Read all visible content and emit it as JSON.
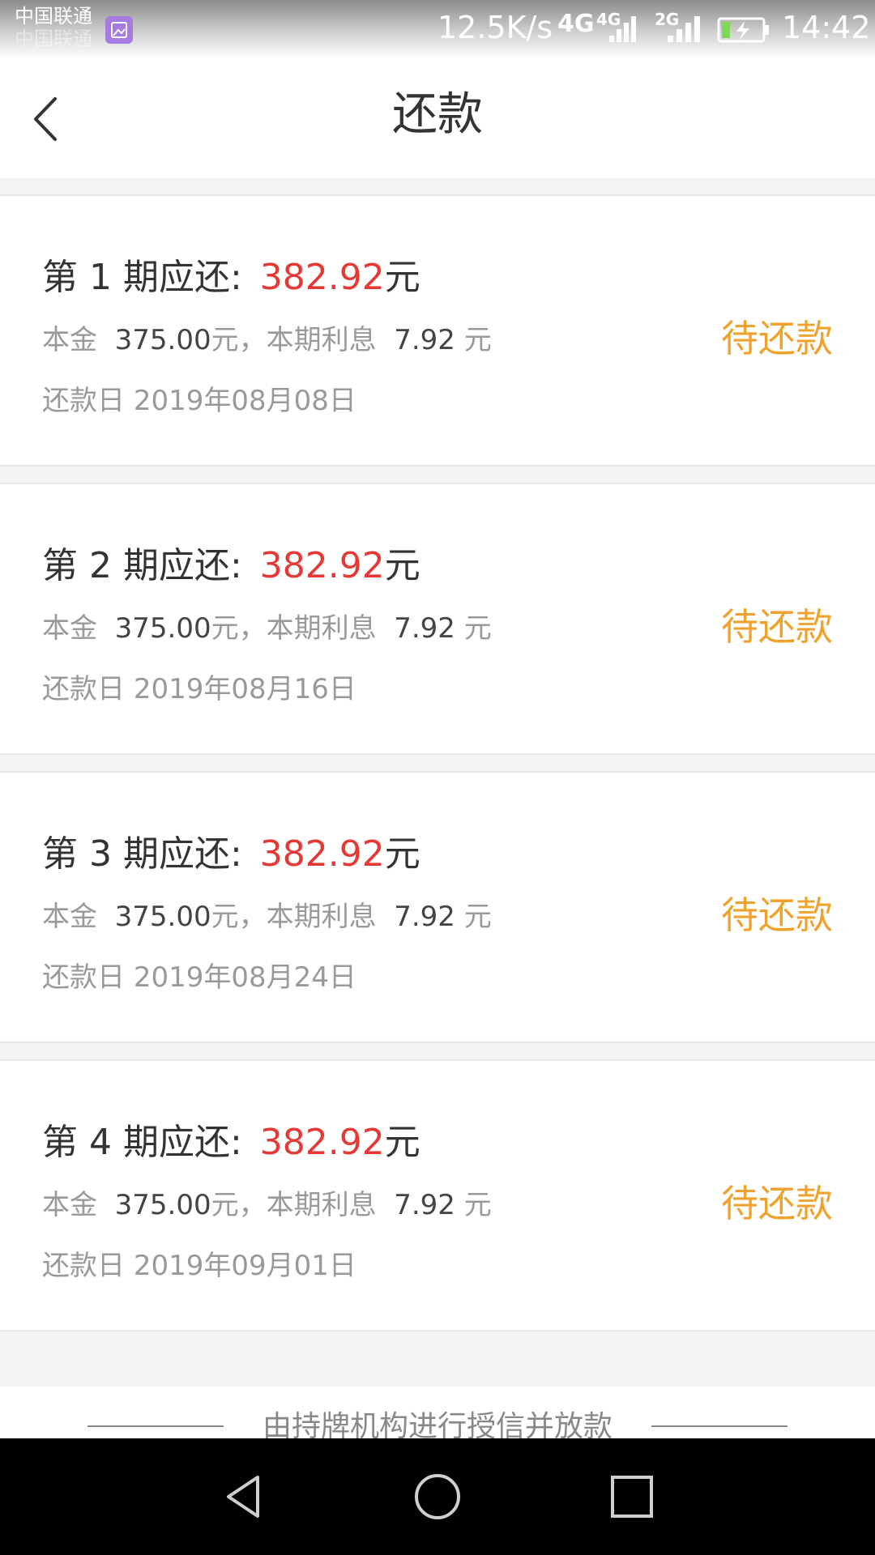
{
  "status_bar": {
    "carrier_1": "中国联通",
    "carrier_2": "中国联通",
    "speed": "12.5K/s",
    "network_main": "4G",
    "network_sim1": "4G",
    "network_sim2": "2G",
    "time": "14:42",
    "icons": [
      "gallery-icon",
      "signal-icon",
      "signal-icon",
      "battery-charging-icon"
    ]
  },
  "header": {
    "title": "还款",
    "back_icon": "chevron-left-icon"
  },
  "colors": {
    "amount": "#e53935",
    "status": "#f0a22e",
    "text_primary": "#333333",
    "text_secondary": "#999999"
  },
  "installments": [
    {
      "title": "第 1 期应还:",
      "amount": "382.92",
      "amount_unit": "元",
      "principal_label": "本金",
      "principal": "375.00",
      "principal_unit": "元，本期利息",
      "interest": "7.92",
      "interest_unit": "元",
      "date_label": "还款日",
      "date": "2019年08月08日",
      "status": "待还款"
    },
    {
      "title": "第 2 期应还:",
      "amount": "382.92",
      "amount_unit": "元",
      "principal_label": "本金",
      "principal": "375.00",
      "principal_unit": "元，本期利息",
      "interest": "7.92",
      "interest_unit": "元",
      "date_label": "还款日",
      "date": "2019年08月16日",
      "status": "待还款"
    },
    {
      "title": "第 3 期应还:",
      "amount": "382.92",
      "amount_unit": "元",
      "principal_label": "本金",
      "principal": "375.00",
      "principal_unit": "元，本期利息",
      "interest": "7.92",
      "interest_unit": "元",
      "date_label": "还款日",
      "date": "2019年08月24日",
      "status": "待还款"
    },
    {
      "title": "第 4 期应还:",
      "amount": "382.92",
      "amount_unit": "元",
      "principal_label": "本金",
      "principal": "375.00",
      "principal_unit": "元，本期利息",
      "interest": "7.92",
      "interest_unit": "元",
      "date_label": "还款日",
      "date": "2019年09月01日",
      "status": "待还款"
    }
  ],
  "footer": {
    "note": "由持牌机构进行授信并放款"
  },
  "nav_bar": {
    "icons": [
      "back-triangle-icon",
      "home-circle-icon",
      "recents-square-icon"
    ]
  }
}
